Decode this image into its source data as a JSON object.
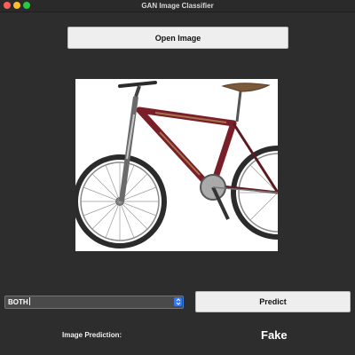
{
  "window": {
    "title": "GAN Image Classifier"
  },
  "toolbar": {
    "open_image_label": "Open Image"
  },
  "image": {
    "subject": "bicycle"
  },
  "model_select": {
    "selected": "BOTH"
  },
  "predict": {
    "label": "Predict"
  },
  "result": {
    "label": "Image Prediction:",
    "value": "Fake"
  },
  "colors": {
    "background": "#2d2d2d",
    "accent": "#3478f6",
    "button_bg": "#eeeeee"
  },
  "icons": [
    "close-icon",
    "minimize-icon",
    "zoom-icon",
    "chevron-updown-icon"
  ]
}
